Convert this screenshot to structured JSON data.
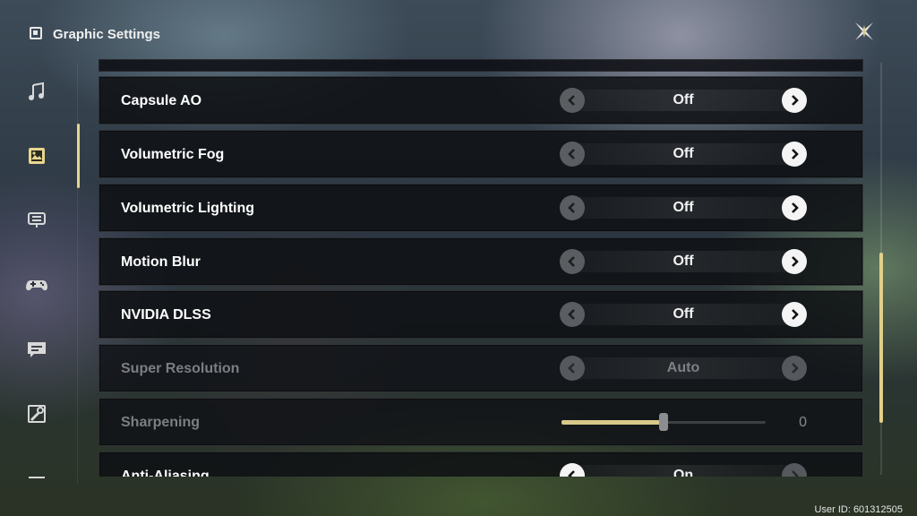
{
  "header": {
    "title": "Graphic Settings",
    "title_icon": "picture-icon",
    "close_icon": "close-x-icon"
  },
  "sidebar": {
    "items": [
      {
        "name": "audio",
        "icon": "music-note-icon",
        "active": false
      },
      {
        "name": "graphics",
        "icon": "picture-icon",
        "active": true
      },
      {
        "name": "controls",
        "icon": "keyboard-icon",
        "active": false
      },
      {
        "name": "gamepad",
        "icon": "gamepad-icon",
        "active": false
      },
      {
        "name": "chat",
        "icon": "chat-bubble-icon",
        "active": false
      },
      {
        "name": "other",
        "icon": "wrench-icon",
        "active": false
      },
      {
        "name": "more",
        "icon": "dash-icon",
        "active": false
      }
    ]
  },
  "settings": [
    {
      "label": "Capsule AO",
      "value": "Off",
      "enabled": true
    },
    {
      "label": "Volumetric Fog",
      "value": "Off",
      "enabled": true
    },
    {
      "label": "Volumetric Lighting",
      "value": "Off",
      "enabled": true
    },
    {
      "label": "Motion Blur",
      "value": "Off",
      "enabled": true
    },
    {
      "label": "NVIDIA DLSS",
      "value": "Off",
      "enabled": true
    },
    {
      "label": "Super Resolution",
      "value": "Auto",
      "enabled": false
    },
    {
      "label": "Sharpening",
      "value": "0",
      "enabled": false,
      "slider_fraction": 0.5
    },
    {
      "label": "Anti-Aliasing",
      "value": "On",
      "enabled": true
    }
  ],
  "footer": {
    "user_id": "User ID: 601312505"
  },
  "colors": {
    "accent": "#e1d08a",
    "row_bg": "#0e1014",
    "text": "#ffffff",
    "disabled_text": "#7b7e83"
  }
}
